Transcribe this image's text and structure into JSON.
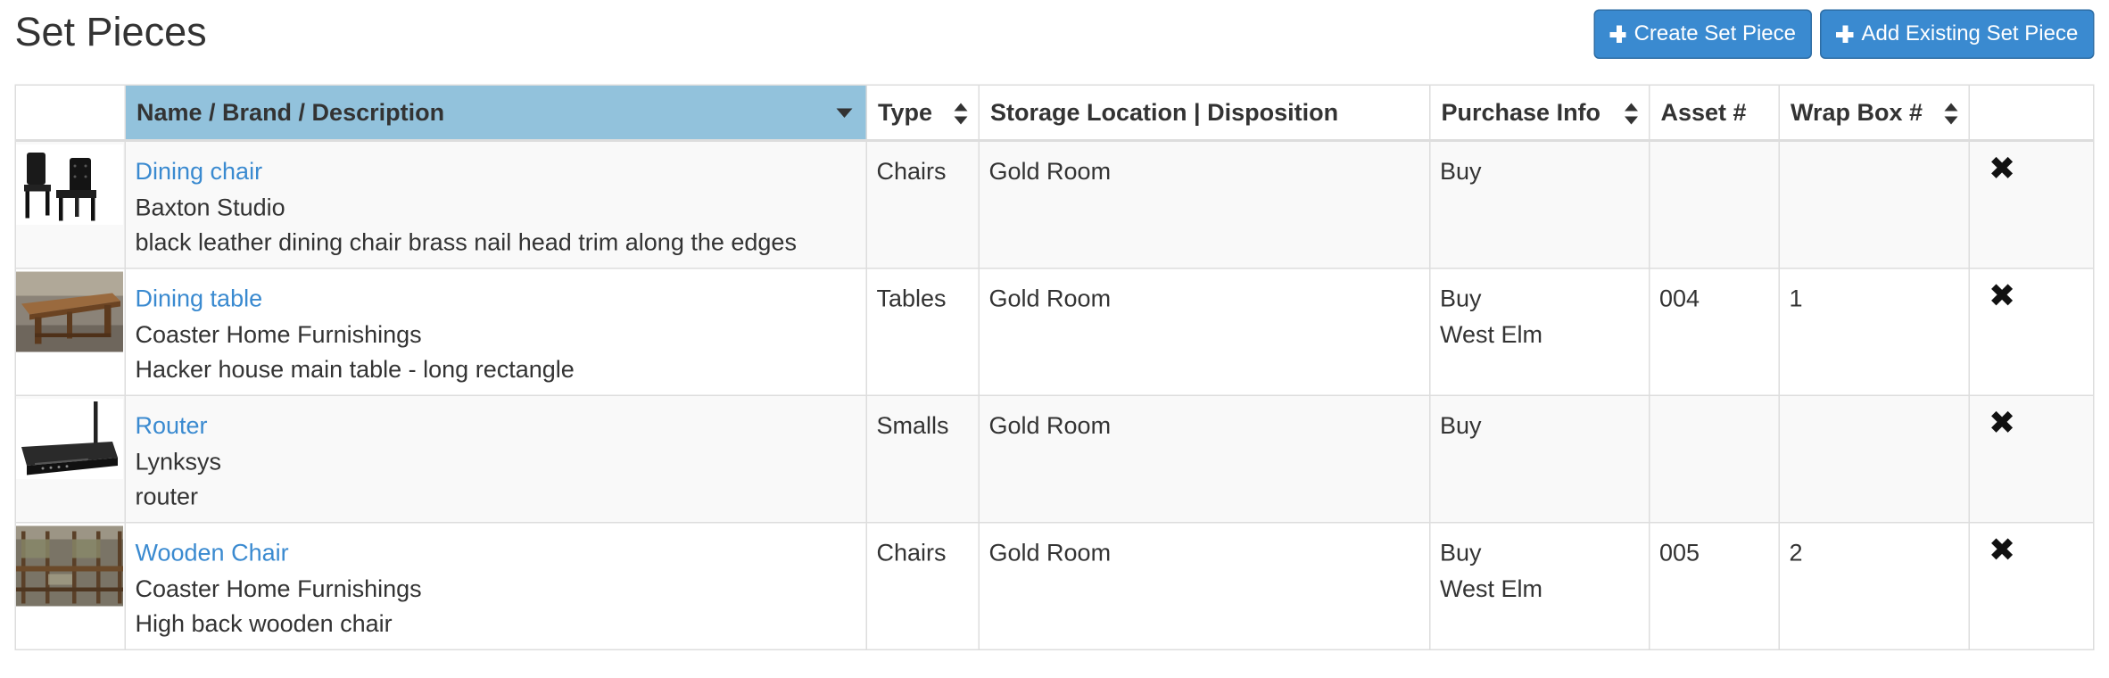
{
  "page": {
    "title": "Set Pieces"
  },
  "actions": {
    "create_label": "Create Set Piece",
    "add_existing_label": "Add Existing Set Piece"
  },
  "table": {
    "headers": {
      "name": "Name / Brand / Description",
      "type": "Type",
      "storage": "Storage Location | Disposition",
      "purchase": "Purchase Info",
      "asset": "Asset #",
      "wrapbox": "Wrap Box #"
    },
    "sorted_column": "name",
    "sort_direction": "descending",
    "remove_icon": "✖",
    "rows": [
      {
        "thumbnail": "dining-chair-image",
        "name": "Dining chair",
        "brand": "Baxton Studio",
        "description": "black leather dining chair brass nail head trim along the edges",
        "type": "Chairs",
        "storage": "Gold Room",
        "purchase_type": "Buy",
        "vendor": "",
        "asset": "",
        "wrapbox": ""
      },
      {
        "thumbnail": "dining-table-image",
        "name": "Dining table",
        "brand": "Coaster Home Furnishings",
        "description": "Hacker house main table - long rectangle",
        "type": "Tables",
        "storage": "Gold Room",
        "purchase_type": "Buy",
        "vendor": "West Elm",
        "asset": "004",
        "wrapbox": "1"
      },
      {
        "thumbnail": "router-image",
        "name": "Router",
        "brand": "Lynksys",
        "description": "router",
        "type": "Smalls",
        "storage": "Gold Room",
        "purchase_type": "Buy",
        "vendor": "",
        "asset": "",
        "wrapbox": ""
      },
      {
        "thumbnail": "wooden-chair-image",
        "name": "Wooden Chair",
        "brand": "Coaster Home Furnishings",
        "description": "High back wooden chair",
        "type": "Chairs",
        "storage": "Gold Room",
        "purchase_type": "Buy",
        "vendor": "West Elm",
        "asset": "005",
        "wrapbox": "2"
      }
    ]
  },
  "colors": {
    "primary": "#3a8ad0",
    "sorted_header": "#92c2dc",
    "border": "#dddddd"
  }
}
